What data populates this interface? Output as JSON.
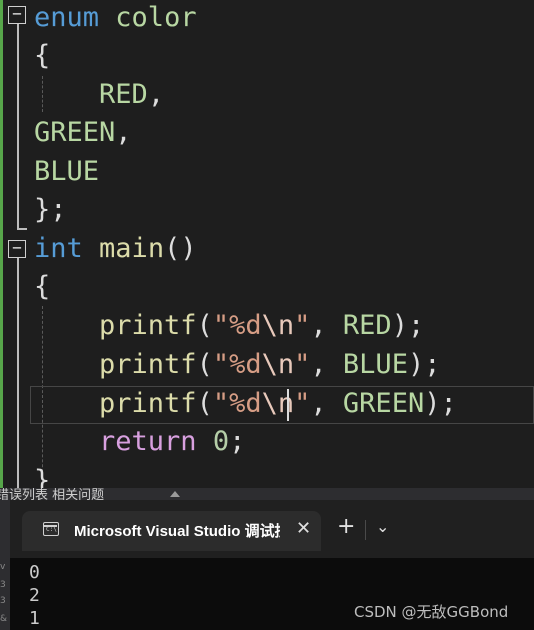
{
  "editor": {
    "code": {
      "l1": {
        "kw": "enum",
        "name": "color"
      },
      "l2": "{",
      "l3": {
        "const": "RED",
        "punc": ","
      },
      "l4": {
        "const": "GREEN",
        "punc": ","
      },
      "l5": {
        "const": "BLUE"
      },
      "l6": "};",
      "l7": {
        "kw": "int",
        "fn": "main",
        "paren": "()"
      },
      "l8": "{",
      "l9": {
        "fn": "printf",
        "open": "(",
        "str1": "\"%d",
        "esc": "\\n",
        "str2": "\"",
        "sep": ", ",
        "arg": "RED",
        "close": ");"
      },
      "l10": {
        "fn": "printf",
        "open": "(",
        "str1": "\"%d",
        "esc": "\\n",
        "str2": "\"",
        "sep": ", ",
        "arg": "BLUE",
        "close": ");"
      },
      "l11": {
        "fn": "printf",
        "open": "(",
        "str1": "\"%d",
        "esc": "\\n",
        "str2": "\"",
        "sep": ", ",
        "arg": "GREEN",
        "close": ");"
      },
      "l12": {
        "kw": "return",
        "num": "0",
        "punc": ";"
      },
      "l13": "}"
    },
    "fold_toggle": "−"
  },
  "panel": {
    "title": "错误列表 相关问题"
  },
  "terminal": {
    "tab_title": "Microsoft Visual Studio 调试控制台",
    "tab_icon_text": "C:\\",
    "close_glyph": "✕",
    "new_tab_glyph": "+",
    "dropdown_glyph": "⌄",
    "output": [
      "0",
      "2",
      "1"
    ]
  },
  "left_strip_text": [
    "v",
    "3",
    "3",
    "&"
  ],
  "watermark": "CSDN @无敌GGBond",
  "colors": {
    "keyword": "#569cd6",
    "enum_constant": "#b8d7a3",
    "function": "#dcdcaa",
    "string": "#d69d85",
    "number": "#b5cea8",
    "control_keyword": "#d8a0df",
    "gutter_change": "#57a64a"
  }
}
